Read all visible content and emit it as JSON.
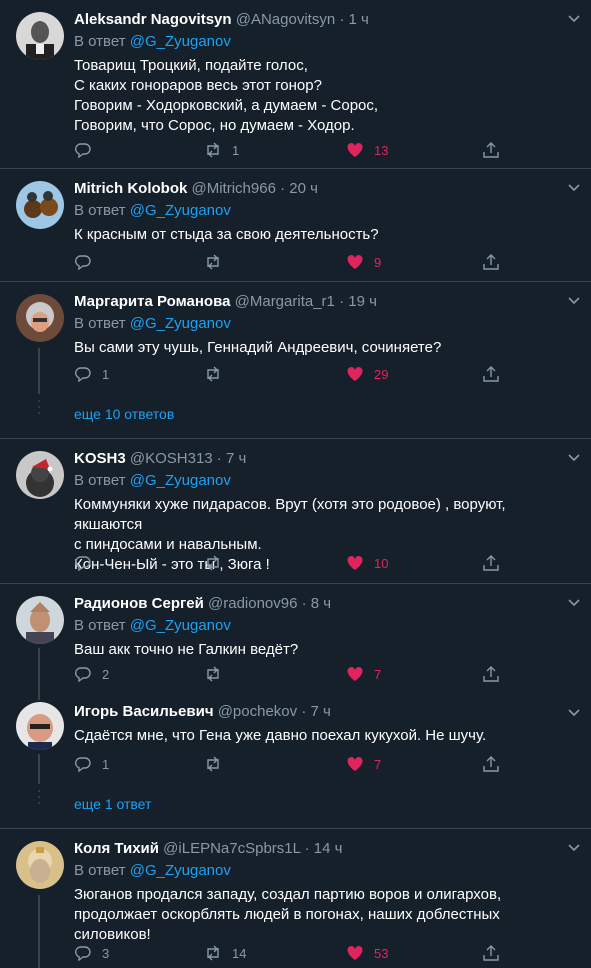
{
  "tweets": [
    {
      "name": "Aleksandr Nagovitsyn",
      "handle": "@ANagovitsyn",
      "time": "· 1 ч",
      "reply_prefix": "В ответ ",
      "reply_to": "@G_Zyuganov",
      "text": "Товарищ Троцкий, подайте голос,\nС каких гонораров весь этот гонор?\nГоворим - Ходорковский, а думаем - Сорос,\nГоворим, что Сорос, но думаем - Ходор.",
      "replies": "",
      "retweets": "1",
      "likes": "13"
    },
    {
      "name": "Mitrich Kolobok",
      "handle": "@Mitrich966",
      "time": "· 20 ч",
      "reply_prefix": "В ответ ",
      "reply_to": "@G_Zyuganov",
      "text": "К красным от стыда за свою деятельность?",
      "replies": "",
      "retweets": "",
      "likes": "9"
    },
    {
      "name": "Маргарита Романова",
      "handle": "@Margarita_r1",
      "time": "· 19 ч",
      "reply_prefix": "В ответ ",
      "reply_to": "@G_Zyuganov",
      "text": "Вы сами эту чушь, Геннадий Андреевич, сочиняете?",
      "replies": "1",
      "retweets": "",
      "likes": "29"
    },
    {
      "name": "KOSH3",
      "handle": "@KOSH313",
      "time": "· 7 ч",
      "reply_prefix": "В ответ ",
      "reply_to": "@G_Zyuganov",
      "text": "Коммуняки хуже пидарасов. Врут (хотя это родовое) , воруют, якшаются\nс пиндосами и навальным.\nКон-Чен-Ый - это ты , Зюга !",
      "replies": "",
      "retweets": "",
      "likes": "10"
    },
    {
      "name": "Радионов Сергей",
      "handle": "@radionov96",
      "time": "· 8 ч",
      "reply_prefix": "В ответ ",
      "reply_to": "@G_Zyuganov",
      "text": "Ваш акк точно не Галкин ведёт?",
      "replies": "2",
      "retweets": "",
      "likes": "7"
    },
    {
      "name": "Игорь Васильевич",
      "handle": "@pochekov",
      "time": "· 7 ч",
      "reply_prefix": "",
      "reply_to": "",
      "text": "Сдаётся мне, что Гена уже давно поехал кукухой. Не шучу.",
      "replies": "1",
      "retweets": "",
      "likes": "7"
    },
    {
      "name": "Коля Тихий",
      "handle": "@iLEPNa7cSpbrs1L",
      "time": "· 14 ч",
      "reply_prefix": "В ответ ",
      "reply_to": "@G_Zyuganov",
      "text": "Зюганов продался западу, создал партию воров и олигархов,\nпродолжает оскорблять людей в погонах, наших доблестных\nсиловиков!",
      "replies": "3",
      "retweets": "14",
      "likes": "53"
    }
  ],
  "more_replies": [
    "еще 10 ответов",
    "еще 1 ответ"
  ],
  "colors": {
    "background": "#15202b",
    "accent": "#1da1f2",
    "like": "#e0245e",
    "muted": "#8899a6",
    "divider": "#38444d"
  }
}
